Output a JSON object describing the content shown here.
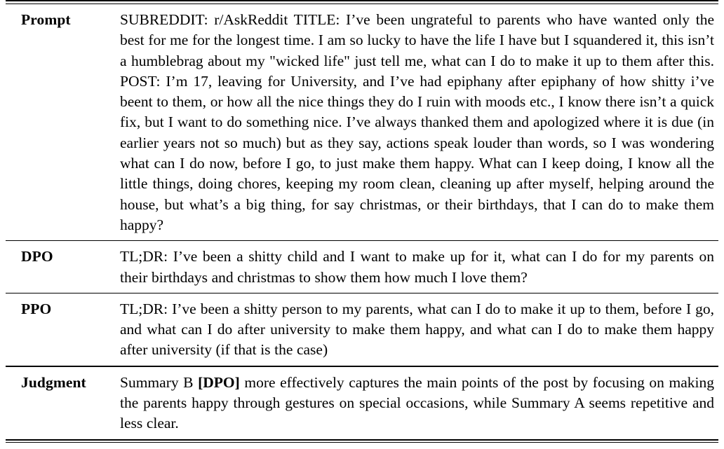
{
  "table": {
    "rows": [
      {
        "id": "prompt",
        "label": "Prompt",
        "text": "SUBREDDIT: r/AskReddit TITLE: I’ve been ungrateful to parents who have wanted only the best for me for the longest time. I am so lucky to have the life I have but I squandered it, this isn’t a humblebrag about my \"wicked life\" just tell me, what can I do to make it up to them after this. POST: I’m 17, leaving for University, and I’ve had epiphany after epiphany of how shitty i’ve beent to them, or how all the nice things they do I ruin with moods etc., I know there isn’t a quick fix, but I want to do something nice. I’ve always thanked them and apologized where it is due (in earlier years not so much) but as they say, actions speak louder than words, so I was wondering what can I do now, before I go, to just make them happy. What can I keep doing, I know all the little things, doing chores, keeping my room clean, cleaning up after myself, helping around the house, but what’s a big thing, for say christmas, or their birthdays, that I can do to make them happy?"
      },
      {
        "id": "dpo",
        "label": "DPO",
        "text": "TL;DR: I’ve been a shitty child and I want to make up for it, what can I do for my parents on their birthdays and christmas to show them how much I love them?"
      },
      {
        "id": "ppo",
        "label": "PPO",
        "text": "TL;DR: I’ve been a shitty person to my parents, what can I do to make it up to them, before I go, and what can I do after university to make them happy, and what can I do to make them happy after university (if that is the case)"
      },
      {
        "id": "judgment",
        "label": "Judgment",
        "text_before": "Summary B ",
        "text_bold": "[DPO]",
        "text_after": " more effectively captures the main points of the post by focusing on making the parents happy through gestures on special occasions, while Summary A seems repetitive and less clear."
      }
    ]
  }
}
